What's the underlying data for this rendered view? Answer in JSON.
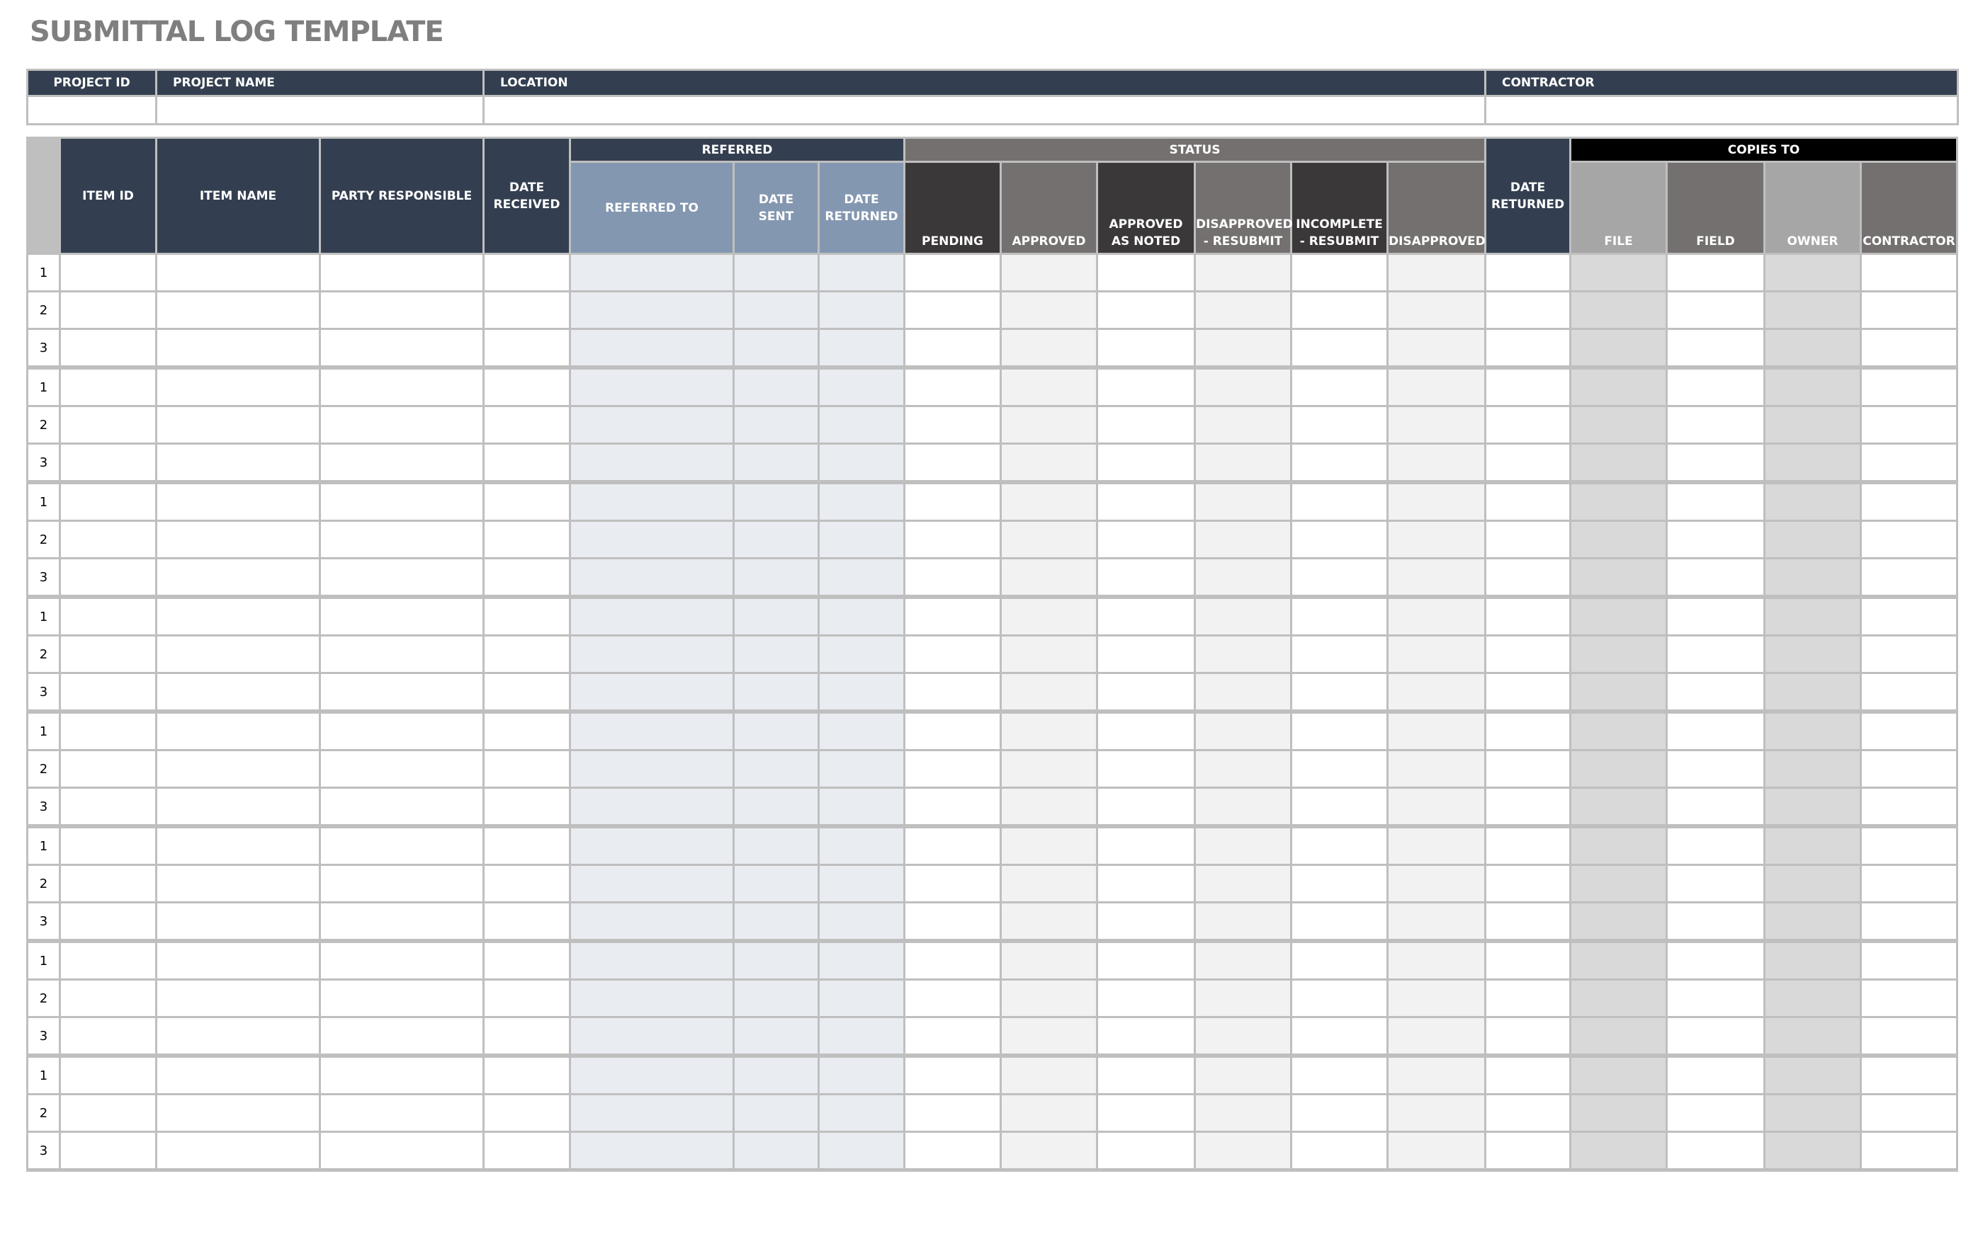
{
  "title": "SUBMITTAL LOG TEMPLATE",
  "project": {
    "headers": [
      "PROJECT ID",
      "PROJECT NAME",
      "LOCATION",
      "CONTRACTOR"
    ],
    "values": [
      "",
      "",
      "",
      ""
    ]
  },
  "log": {
    "groups": {
      "referred": "REFERRED",
      "status": "STATUS",
      "copies_to": "COPIES TO"
    },
    "columns": {
      "item_id": "ITEM ID",
      "item_name": "ITEM NAME",
      "party_responsible": "PARTY RESPONSIBLE",
      "date_received_1": "DATE",
      "date_received_2": "RECEIVED",
      "referred_to": "REFERRED TO",
      "date_sent_1": "DATE",
      "date_sent_2": "SENT",
      "date_returned_ref_1": "DATE",
      "date_returned_ref_2": "RETURNED",
      "pending": "PENDING",
      "approved": "APPROVED",
      "approved_as_noted_1": "APPROVED",
      "approved_as_noted_2": "AS NOTED",
      "disapproved_resubmit_1": "DISAPPROVED",
      "disapproved_resubmit_2": "- RESUBMIT",
      "incomplete_resubmit_1": "INCOMPLETE",
      "incomplete_resubmit_2": "- RESUBMIT",
      "disapproved": "DISAPPROVED",
      "date_returned_1": "DATE",
      "date_returned_2": "RETURNED",
      "file": "FILE",
      "field": "FIELD",
      "owner": "OWNER",
      "contractor": "CONTRACTOR"
    },
    "row_numbers": [
      "1",
      "2",
      "3",
      "1",
      "2",
      "3",
      "1",
      "2",
      "3",
      "1",
      "2",
      "3",
      "1",
      "2",
      "3",
      "1",
      "2",
      "3",
      "1",
      "2",
      "3",
      "1",
      "2",
      "3"
    ]
  },
  "colors": {
    "navy": "#333f50",
    "slate": "#8497b0",
    "taupe": "#757070",
    "dark": "#3a3838",
    "black": "#000000",
    "light_gray": "#a6a6a6",
    "title_gray": "#7f7f7f"
  }
}
